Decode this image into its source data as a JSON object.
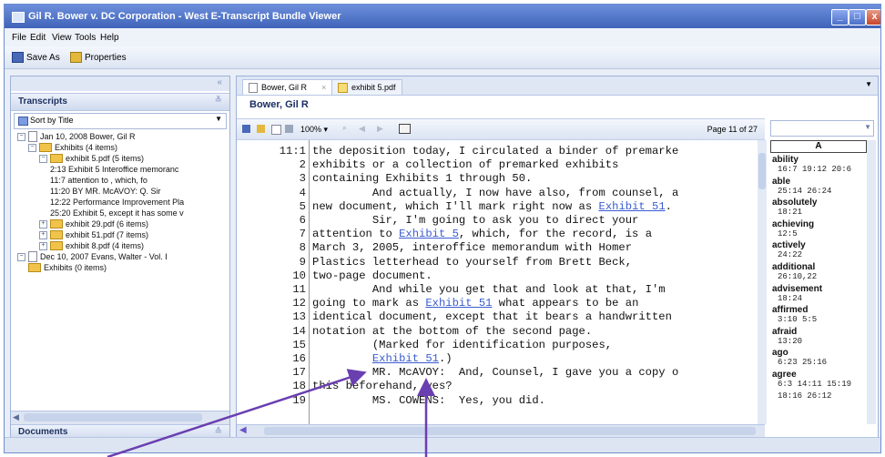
{
  "window": {
    "title": "Gil R. Bower v. DC Corporation - West E-Transcript Bundle Viewer",
    "buttons": [
      "_",
      "□",
      "x"
    ]
  },
  "menu": [
    "File",
    "Edit",
    "View",
    "Tools",
    "Help"
  ],
  "toolbar": {
    "save_as": "Save As",
    "properties": "Properties"
  },
  "left_panel": {
    "collapse_glyph": "«",
    "transcripts_header": "Transcripts",
    "sort_label": "Sort by Title",
    "tree": [
      {
        "level": 0,
        "toggle": "−",
        "icon": "document",
        "text": "Jan 10, 2008  Bower, Gil R"
      },
      {
        "level": 1,
        "toggle": "−",
        "icon": "folder",
        "text": "Exhibits (4 items)"
      },
      {
        "level": 2,
        "toggle": "−",
        "icon": "folder",
        "text": "exhibit 5.pdf (5 items)"
      },
      {
        "level": 3,
        "toggle": "",
        "icon": "",
        "text": "2:13  Exhibit 5  Interoffice memoranc"
      },
      {
        "level": 3,
        "toggle": "",
        "icon": "",
        "text": "11:7  attention to                , which, fo"
      },
      {
        "level": 3,
        "toggle": "",
        "icon": "",
        "text": "11:20        BY MR. McAVOY:  Q.  Sir"
      },
      {
        "level": 3,
        "toggle": "",
        "icon": "",
        "text": "12:22  Performance Improvement Pla"
      },
      {
        "level": 3,
        "toggle": "",
        "icon": "",
        "text": "25:20  Exhibit 5, except it has some v"
      },
      {
        "level": 2,
        "toggle": "+",
        "icon": "folder",
        "text": "exhibit 29.pdf (6 items)"
      },
      {
        "level": 2,
        "toggle": "+",
        "icon": "folder",
        "text": "exhibit 51.pdf (7 items)"
      },
      {
        "level": 2,
        "toggle": "+",
        "icon": "folder",
        "text": "exhibit 8.pdf (4 items)"
      },
      {
        "level": 0,
        "toggle": "−",
        "icon": "document",
        "text": "Dec 10, 2007  Evans, Walter - Vol. I"
      },
      {
        "level": 1,
        "toggle": "",
        "icon": "folder",
        "text": "Exhibits (0 items)"
      }
    ],
    "documents_header": "Documents"
  },
  "tabs": [
    {
      "label": "Bower, Gil R",
      "close": "×",
      "active": true
    },
    {
      "label": "exhibit 5.pdf",
      "close": "",
      "active": false
    }
  ],
  "document_title": "Bower, Gil R",
  "viewer_toolbar": {
    "zoom": "100%",
    "page_indicator": "Page 11 of 27"
  },
  "transcript": [
    {
      "n": "11:1",
      "segs": [
        {
          "t": "the deposition today, I circulated a binder of premarke"
        }
      ]
    },
    {
      "n": "2",
      "segs": [
        {
          "t": "exhibits or a collection of premarked exhibits"
        }
      ]
    },
    {
      "n": "3",
      "segs": [
        {
          "t": "containing Exhibits 1 through 50."
        }
      ]
    },
    {
      "n": "4",
      "segs": [
        {
          "t": "         And actually, I now have also, from counsel, a"
        }
      ]
    },
    {
      "n": "5",
      "segs": [
        {
          "t": "new document, which I'll mark right now as "
        },
        {
          "t": "Exhibit 51",
          "link": true
        },
        {
          "t": "."
        }
      ]
    },
    {
      "n": "6",
      "segs": [
        {
          "t": "         Sir, I'm going to ask you to direct your"
        }
      ]
    },
    {
      "n": "7",
      "segs": [
        {
          "t": "attention to "
        },
        {
          "t": "Exhibit 5",
          "link": true
        },
        {
          "t": ", which, for the record, is a"
        }
      ]
    },
    {
      "n": "8",
      "segs": [
        {
          "t": "March 3, 2005, interoffice memorandum with Homer"
        }
      ]
    },
    {
      "n": "9",
      "segs": [
        {
          "t": "Plastics letterhead to yourself from Brett Beck,"
        }
      ]
    },
    {
      "n": "10",
      "segs": [
        {
          "t": "two-page document."
        }
      ]
    },
    {
      "n": "11",
      "segs": [
        {
          "t": "         And while you get that and look at that, I'm"
        }
      ]
    },
    {
      "n": "12",
      "segs": [
        {
          "t": "going to mark as "
        },
        {
          "t": "Exhibit 51",
          "link": true
        },
        {
          "t": " what appears to be an"
        }
      ]
    },
    {
      "n": "13",
      "segs": [
        {
          "t": "identical document, except that it bears a handwritten"
        }
      ]
    },
    {
      "n": "14",
      "segs": [
        {
          "t": "notation at the bottom of the second page."
        }
      ]
    },
    {
      "n": "15",
      "segs": [
        {
          "t": "         (Marked for identification purposes,"
        }
      ]
    },
    {
      "n": "16",
      "segs": [
        {
          "t": "         "
        },
        {
          "t": "Exhibit 51",
          "link": true
        },
        {
          "t": ".)"
        }
      ]
    },
    {
      "n": "17",
      "segs": [
        {
          "t": "         MR. McAVOY:  And, Counsel, I gave you a copy o"
        }
      ]
    },
    {
      "n": "18",
      "segs": [
        {
          "t": "this beforehand, yes?"
        }
      ]
    },
    {
      "n": "19",
      "segs": [
        {
          "t": "         MS. COWENS:  Yes, you did."
        }
      ]
    }
  ],
  "word_index": {
    "header": "A",
    "entries": [
      {
        "word": "ability",
        "pages": "16:7 19:12 20:6"
      },
      {
        "word": "able",
        "pages": "25:14 26:24"
      },
      {
        "word": "absolutely",
        "pages": "18:21"
      },
      {
        "word": "achieving",
        "pages": "12:5"
      },
      {
        "word": "actively",
        "pages": "24:22"
      },
      {
        "word": "additional",
        "pages": "26:10,22"
      },
      {
        "word": "advisement",
        "pages": "18:24"
      },
      {
        "word": "affirmed",
        "pages": "3:10 5:5"
      },
      {
        "word": "afraid",
        "pages": "13:20"
      },
      {
        "word": "ago",
        "pages": "6:23 25:16"
      },
      {
        "word": "agree",
        "pages": "6:3 14:11 15:19"
      },
      {
        "word": "",
        "pages": "18:16 26:12"
      }
    ]
  },
  "colors": {
    "title_bar": "#3f63b8",
    "link": "#3a5cd0",
    "callout_arrow": "#6a3fb0"
  }
}
